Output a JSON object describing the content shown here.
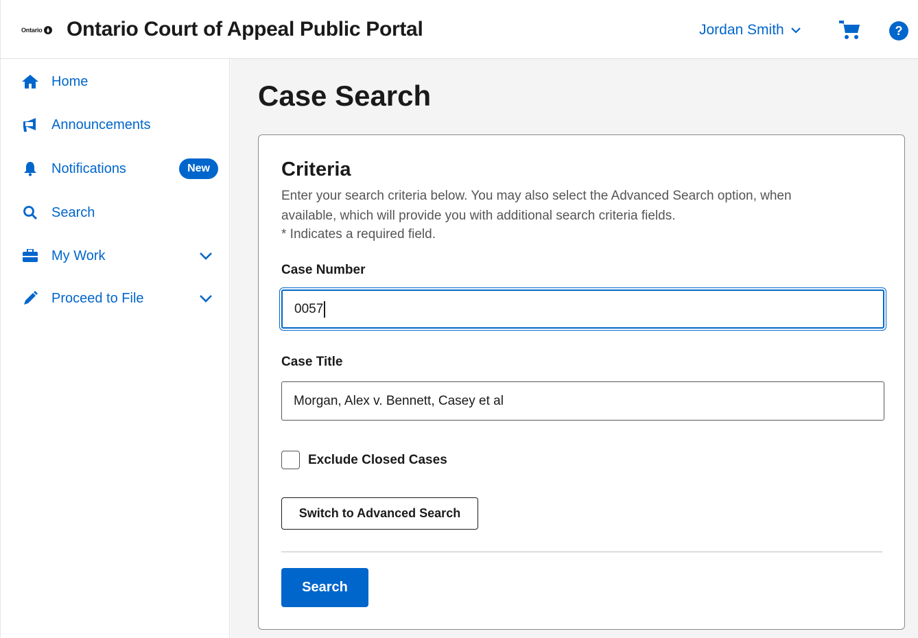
{
  "header": {
    "logo_text": "Ontario",
    "title": "Ontario Court of Appeal Public Portal",
    "user_name": "Jordan Smith",
    "help_label": "?"
  },
  "sidebar": {
    "items": [
      {
        "label": "Home",
        "icon": "home-icon"
      },
      {
        "label": "Announcements",
        "icon": "megaphone-icon"
      },
      {
        "label": "Notifications",
        "icon": "bell-icon",
        "badge": "New"
      },
      {
        "label": "Search",
        "icon": "search-icon"
      },
      {
        "label": "My Work",
        "icon": "briefcase-icon",
        "expandable": true
      },
      {
        "label": "Proceed to File",
        "icon": "pencil-icon",
        "expandable": true
      }
    ]
  },
  "main": {
    "page_title": "Case Search",
    "criteria": {
      "heading": "Criteria",
      "description": "Enter your search criteria below. You may also select the Advanced Search option, when available, which will provide you with additional search criteria fields.",
      "required_note": "* Indicates a required field.",
      "case_number_label": "Case Number",
      "case_number_value": "0057",
      "case_title_label": "Case Title",
      "case_title_value": "Morgan, Alex v. Bennett, Casey et al",
      "exclude_closed_label": "Exclude Closed Cases",
      "exclude_closed_checked": false,
      "advanced_button": "Switch to Advanced Search",
      "search_button": "Search"
    }
  },
  "colors": {
    "accent": "#0066cc",
    "text": "#1a1a1a",
    "muted": "#555555",
    "main_bg": "#f4f4f4"
  }
}
